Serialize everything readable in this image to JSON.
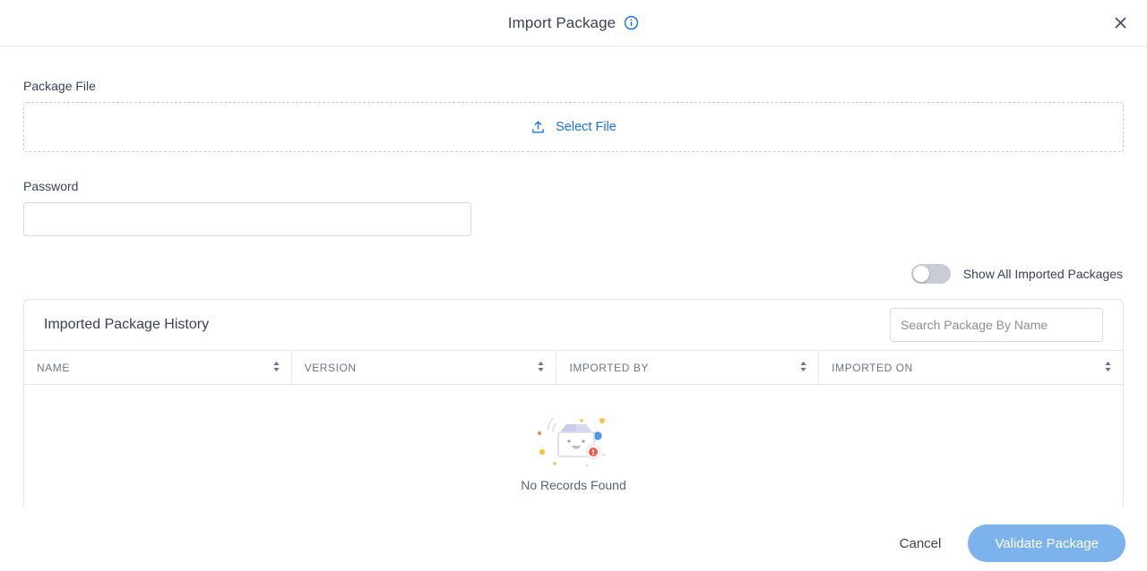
{
  "header": {
    "title": "Import Package",
    "info_icon": "info-circle-icon",
    "close_icon": "close-icon"
  },
  "form": {
    "package_file_label": "Package File",
    "select_file_label": "Select File",
    "upload_icon": "upload-icon",
    "password_label": "Password",
    "password_value": "",
    "password_placeholder": ""
  },
  "toggle": {
    "label": "Show All Imported Packages",
    "state": "off"
  },
  "history": {
    "title": "Imported Package History",
    "search_placeholder": "Search Package By Name",
    "search_value": "",
    "columns": [
      {
        "label": "NAME",
        "sort_icon": "sort-updown-icon"
      },
      {
        "label": "VERSION",
        "sort_icon": "sort-updown-icon"
      },
      {
        "label": "IMPORTED BY",
        "sort_icon": "sort-updown-icon"
      },
      {
        "label": "IMPORTED ON",
        "sort_icon": "sort-updown-icon"
      }
    ],
    "rows": [],
    "empty_text": "No Records Found",
    "empty_illustration": "empty-box-icon"
  },
  "footer": {
    "cancel_label": "Cancel",
    "validate_label": "Validate Package"
  },
  "colors": {
    "accent_blue": "#1a73e8",
    "primary_button": "#7db3ec",
    "text_dark": "#39415a",
    "text_muted": "#6b748c",
    "border": "#e3e5e9",
    "toggle_track_off": "#c8ccd4"
  }
}
